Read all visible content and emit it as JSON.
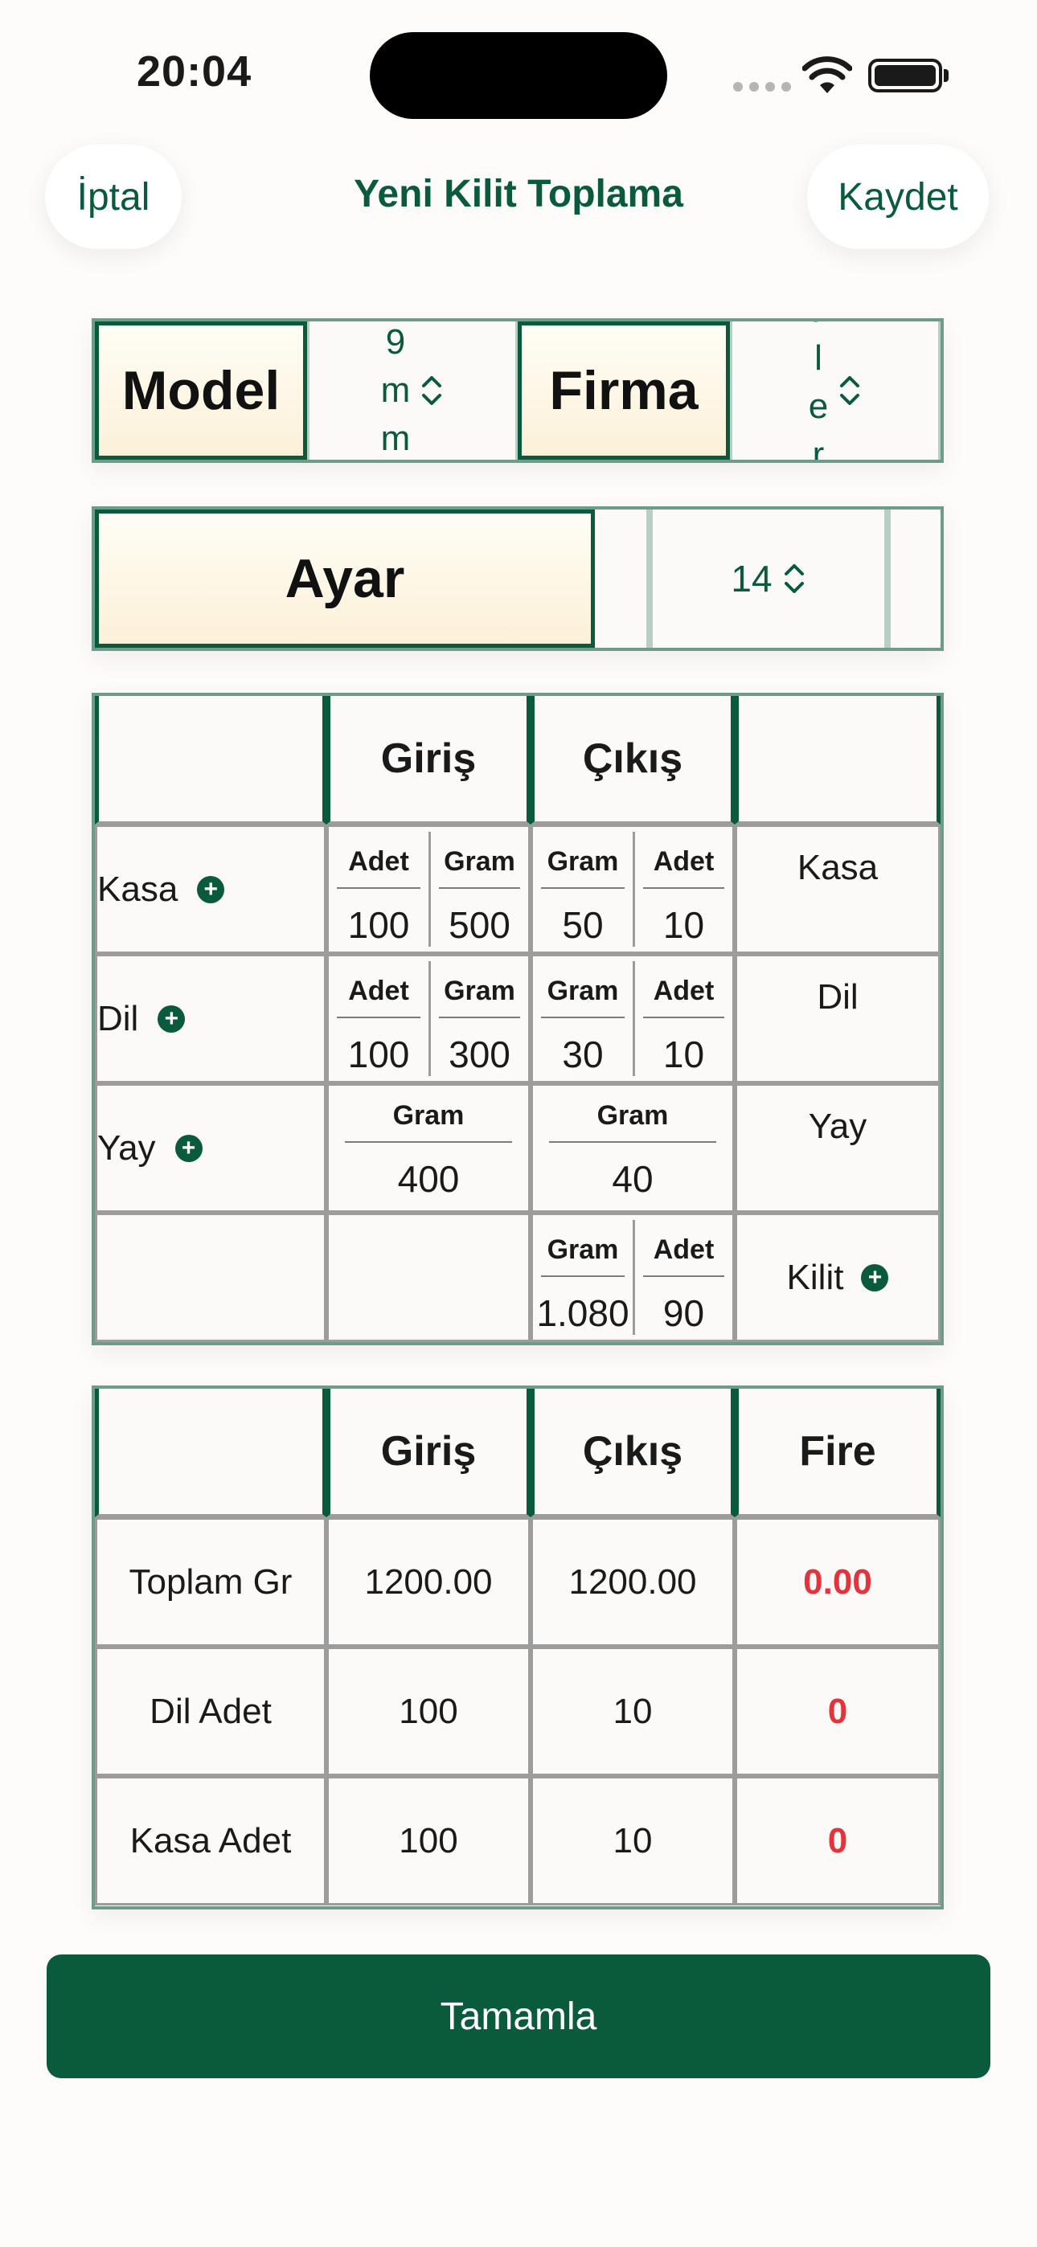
{
  "status": {
    "time": "20:04"
  },
  "nav": {
    "cancel": "İptal",
    "title": "Yeni Kilit Toplama",
    "save": "Kaydet"
  },
  "selectors": {
    "model_label": "Model",
    "model_value_lines": [
      "9",
      "m",
      "m"
    ],
    "firma_label": "Firma",
    "firma_value_lines": [
      "a",
      "l",
      "e",
      "r"
    ],
    "ayar_label": "Ayar",
    "ayar_value": "14"
  },
  "entry_table": {
    "headers": [
      "",
      "Giriş",
      "Çıkış",
      ""
    ],
    "rows": [
      {
        "label": "Kasa",
        "in": [
          {
            "unit": "Adet",
            "value": "100"
          },
          {
            "unit": "Gram",
            "value": "500"
          }
        ],
        "out": [
          {
            "unit": "Gram",
            "value": "50"
          },
          {
            "unit": "Adet",
            "value": "10"
          }
        ],
        "right": "Kasa"
      },
      {
        "label": "Dil",
        "in": [
          {
            "unit": "Adet",
            "value": "100"
          },
          {
            "unit": "Gram",
            "value": "300"
          }
        ],
        "out": [
          {
            "unit": "Gram",
            "value": "30"
          },
          {
            "unit": "Adet",
            "value": "10"
          }
        ],
        "right": "Dil"
      },
      {
        "label": "Yay",
        "in": [
          {
            "unit": "Gram",
            "value": "400"
          }
        ],
        "out": [
          {
            "unit": "Gram",
            "value": "40"
          }
        ],
        "right": "Yay"
      },
      {
        "label": "",
        "in": [],
        "out": [
          {
            "unit": "Gram",
            "value": "1.080"
          },
          {
            "unit": "Adet",
            "value": "90"
          }
        ],
        "right": "Kilit"
      }
    ]
  },
  "summary_table": {
    "headers": [
      "",
      "Giriş",
      "Çıkış",
      "Fire"
    ],
    "rows": [
      [
        "Toplam Gr",
        "1200.00",
        "1200.00",
        "0.00"
      ],
      [
        "Dil Adet",
        "100",
        "10",
        "0"
      ],
      [
        "Kasa Adet",
        "100",
        "10",
        "0"
      ]
    ]
  },
  "complete_button": "Tamamla",
  "colors": {
    "accent": "#0a5a3c",
    "fire": "#e5323b",
    "header_bg": "#fcf1d8"
  }
}
